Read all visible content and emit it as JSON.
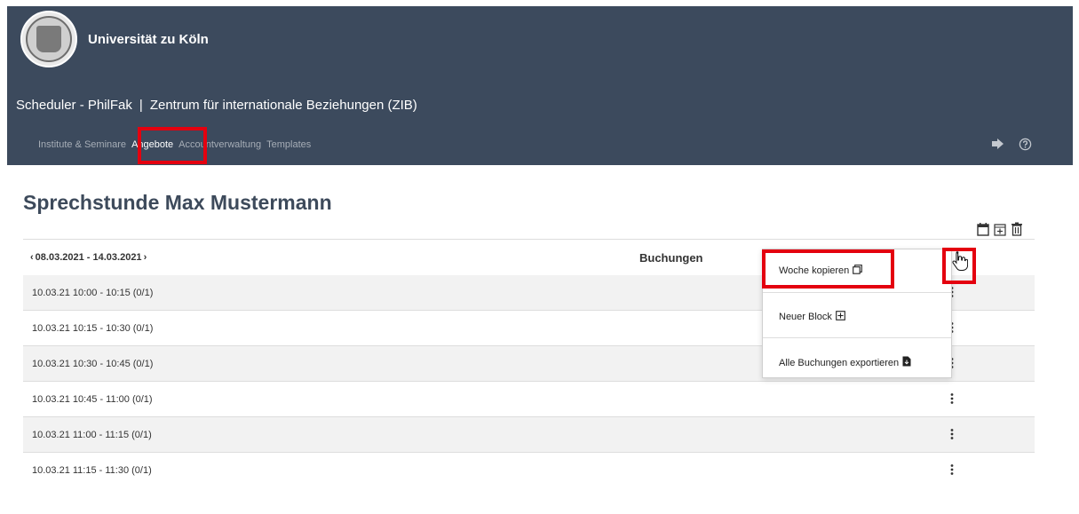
{
  "header": {
    "brand_name": "Universität zu Köln",
    "app_name": "Scheduler - PhilFak",
    "separator": "|",
    "org_name": "Zentrum für internationale Beziehungen (ZIB)",
    "nav": [
      {
        "label": "Institute & Seminare",
        "active": false
      },
      {
        "label": "Angebote",
        "active": true
      },
      {
        "label": "Accountverwaltung",
        "active": false
      },
      {
        "label": "Templates",
        "active": false
      }
    ],
    "icons": [
      "logout-icon",
      "help-icon"
    ]
  },
  "page": {
    "title": "Sprechstunde Max Mustermann",
    "toolbar_icons": [
      "calendar-icon",
      "calendar-add-icon",
      "trash-icon"
    ]
  },
  "table": {
    "prev_arrow": "‹",
    "week_range": "08.03.2021 - 14.03.2021",
    "next_arrow": "›",
    "column_header": "Buchungen",
    "rows": [
      "10.03.21 10:00 - 10:15 (0/1)",
      "10.03.21 10:15 - 10:30 (0/1)",
      "10.03.21 10:30 - 10:45 (0/1)",
      "10.03.21 10:45 - 11:00 (0/1)",
      "10.03.21 11:00 - 11:15 (0/1)",
      "10.03.21 11:15 - 11:30 (0/1)"
    ]
  },
  "dropdown": {
    "items": [
      {
        "label": "Woche kopieren",
        "icon": "copy-icon"
      },
      {
        "label": "Neuer Block",
        "icon": "plus-square-icon"
      },
      {
        "label": "Alle Buchungen exportieren",
        "icon": "file-export-icon"
      }
    ]
  },
  "colors": {
    "header_bg": "#3c4a5d",
    "highlight": "#e4000f",
    "row_alt": "#f2f2f2"
  }
}
